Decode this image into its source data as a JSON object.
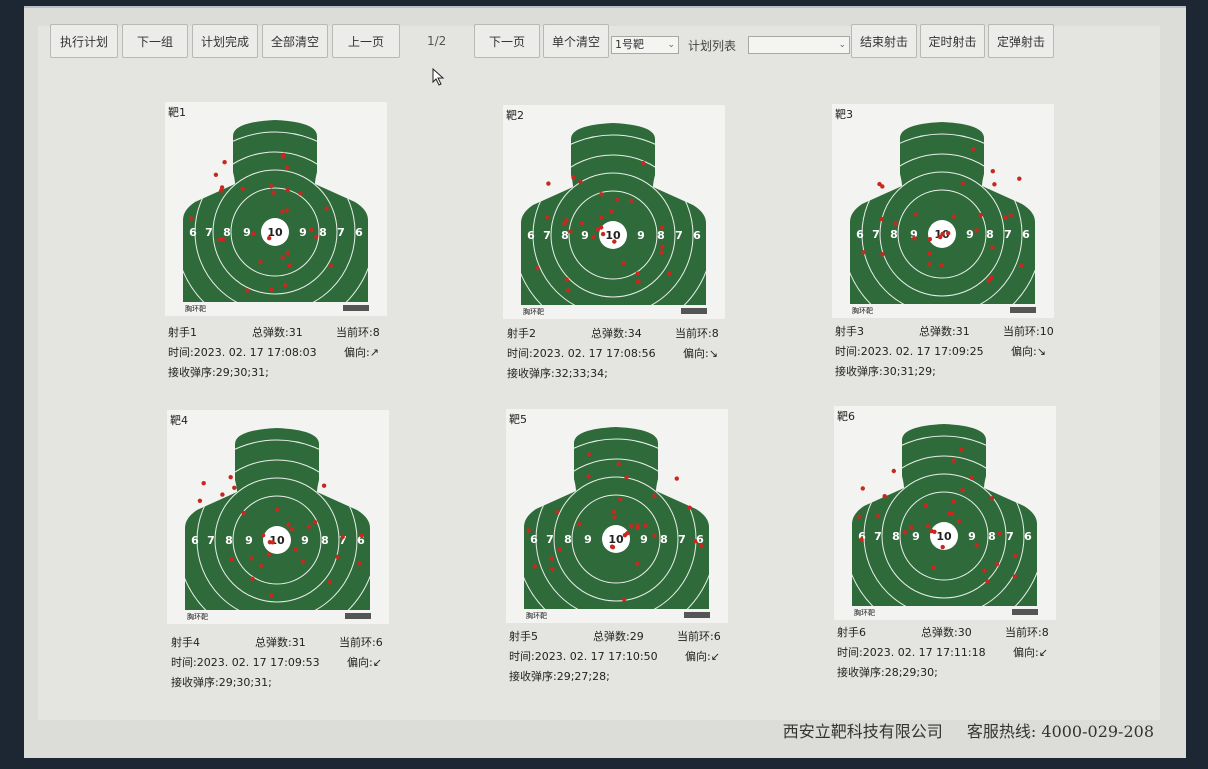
{
  "toolbar": {
    "execute_plan": "执行计划",
    "next_group": "下一组",
    "plan_done": "计划完成",
    "clear_all": "全部清空",
    "prev_page": "上一页",
    "page_indicator": "1/2",
    "next_page": "下一页",
    "clear_single": "单个清空",
    "target_select_value": "1号靶",
    "plan_list_label": "计划列表",
    "plan_list_value": "",
    "end_shooting": "结束射击",
    "timed_shooting": "定时射击",
    "fixed_rounds_shooting": "定弹射击"
  },
  "labels": {
    "total_rounds": "总弹数",
    "current_ring": "当前环",
    "time": "时间",
    "deviation": "偏向",
    "receive_order": "接收弹序",
    "target_type": "胸环靶"
  },
  "rings": [
    "6",
    "7",
    "8",
    "9",
    "10",
    "9",
    "8",
    "7",
    "6"
  ],
  "targets": [
    {
      "title": "靶1",
      "shooter": "射手1",
      "total": ":31",
      "ring": ":8",
      "time": ":2023. 02. 17  17:08:03",
      "dir": ":↗",
      "order": ":29;30;31;"
    },
    {
      "title": "靶2",
      "shooter": "射手2",
      "total": ":34",
      "ring": ":8",
      "time": ":2023. 02. 17  17:08:56",
      "dir": ":↘",
      "order": ":32;33;34;"
    },
    {
      "title": "靶3",
      "shooter": "射手3",
      "total": ":31",
      "ring": ":10",
      "time": ":2023. 02. 17  17:09:25",
      "dir": ":↘",
      "order": ":30;31;29;"
    },
    {
      "title": "靶4",
      "shooter": "射手4",
      "total": ":31",
      "ring": ":6",
      "time": ":2023. 02. 17  17:09:53",
      "dir": ":↙",
      "order": ":29;30;31;"
    },
    {
      "title": "靶5",
      "shooter": "射手5",
      "total": ":29",
      "ring": ":6",
      "time": ":2023. 02. 17  17:10:50",
      "dir": ":↙",
      "order": ":29;27;28;"
    },
    {
      "title": "靶6",
      "shooter": "射手6",
      "total": ":30",
      "ring": ":8",
      "time": ":2023. 02. 17  17:11:18",
      "dir": ":↙",
      "order": ":28;29;30;"
    }
  ],
  "footer": {
    "company": "西安立靶科技有限公司",
    "hotline": "客服热线: 4000-029-208"
  },
  "colors": {
    "target_green": "#2f6b3a",
    "hit_red": "#c8281e",
    "ring_white": "#ffffff"
  }
}
